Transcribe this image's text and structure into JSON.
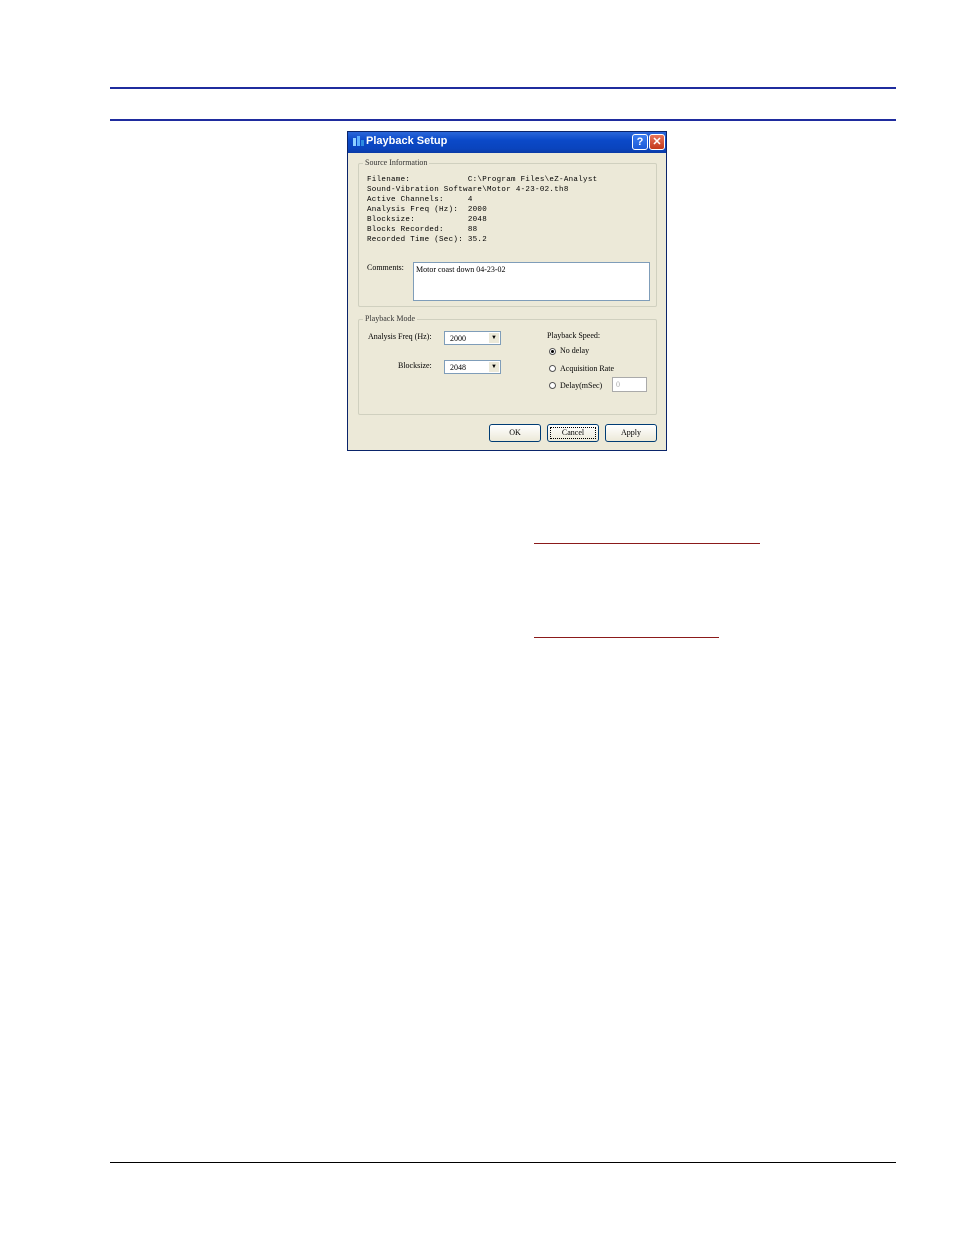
{
  "dialog": {
    "title": "Playback Setup",
    "help_symbol": "?",
    "close_symbol": "✕",
    "source_info": {
      "group_label": "Source Information",
      "rows": [
        "Filename:            C:\\Program Files\\eZ-Analyst",
        "Sound-Vibration Software\\Motor 4-23-02.th8",
        "Active Channels:     4",
        "Analysis Freq (Hz):  2000",
        "Blocksize:           2048",
        "Blocks Recorded:     88",
        "Recorded Time (Sec): 35.2"
      ],
      "comments_label": "Comments:",
      "comments_value": "Motor coast down 04-23-02"
    },
    "playback_mode": {
      "group_label": "Playback Mode",
      "analysis_freq_label": "Analysis Freq (Hz):",
      "analysis_freq_value": "2000",
      "blocksize_label": "Blocksize:",
      "blocksize_value": "2048",
      "playback_speed_label": "Playback Speed:",
      "speed_options": [
        {
          "label": "No delay",
          "selected": true
        },
        {
          "label": "Acquisition Rate",
          "selected": false
        },
        {
          "label": "Delay(mSec)",
          "selected": false
        }
      ],
      "delay_value": "0"
    },
    "buttons": {
      "ok": "OK",
      "cancel": "Cancel",
      "apply": "Apply"
    }
  },
  "colors": {
    "header_rule": "#1f2c9e",
    "link_underline": "#8b1a1a",
    "titlebar": "#0b49c8",
    "dialog_bg": "#ece9d8"
  }
}
